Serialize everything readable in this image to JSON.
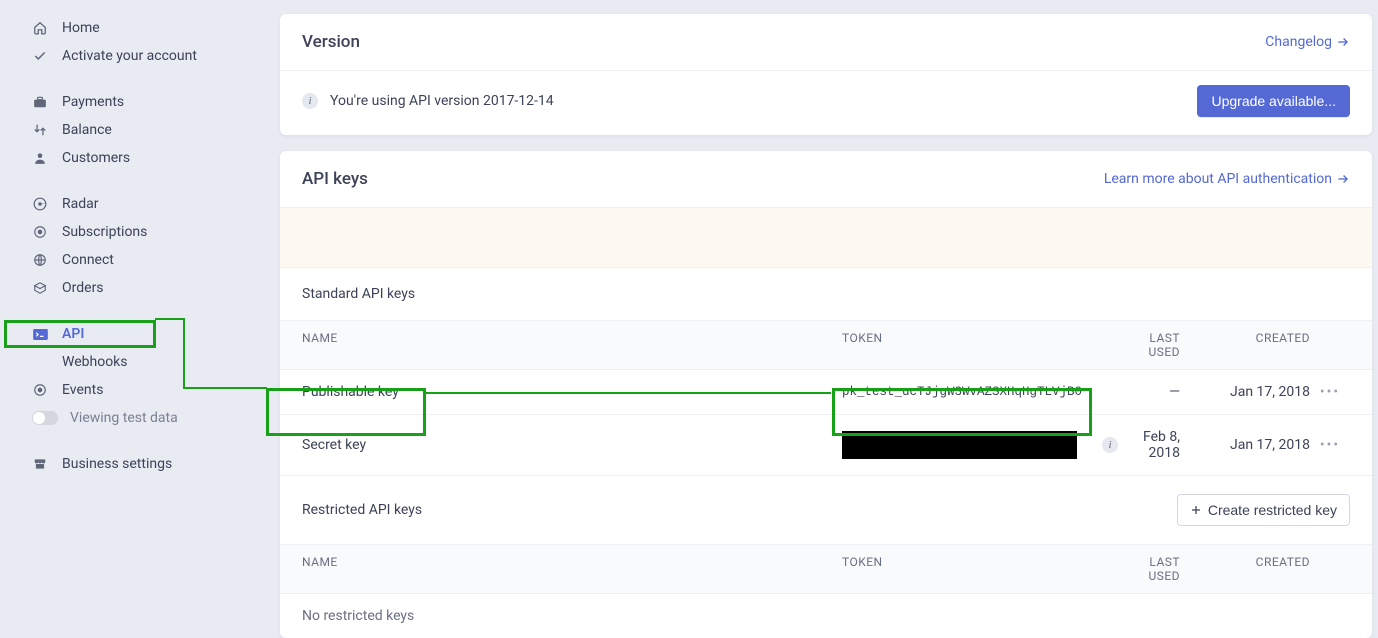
{
  "sidebar": {
    "home": "Home",
    "activate": "Activate your account",
    "payments": "Payments",
    "balance": "Balance",
    "customers": "Customers",
    "radar": "Radar",
    "subscriptions": "Subscriptions",
    "connect": "Connect",
    "orders": "Orders",
    "api": "API",
    "webhooks": "Webhooks",
    "events": "Events",
    "viewing": "Viewing test data",
    "business": "Business settings"
  },
  "version": {
    "title": "Version",
    "changelog": "Changelog",
    "message": "You're using API version 2017-12-14",
    "upgrade": "Upgrade available..."
  },
  "apikeys": {
    "title": "API keys",
    "learn": "Learn more about API authentication",
    "standard_title": "Standard API keys",
    "cols": {
      "name": "NAME",
      "token": "TOKEN",
      "last": "LAST USED",
      "created": "CREATED"
    },
    "rows": [
      {
        "name": "Publishable key",
        "token": "pk_test_ucTJjgW3WvAZSXHqHgTLVjB0",
        "last": "—",
        "created": "Jan 17, 2018"
      },
      {
        "name": "Secret key",
        "token": "",
        "last": "Feb 8, 2018",
        "created": "Jan 17, 2018"
      }
    ],
    "restricted_title": "Restricted API keys",
    "create_btn": "Create restricted key",
    "empty": "No restricted keys"
  }
}
